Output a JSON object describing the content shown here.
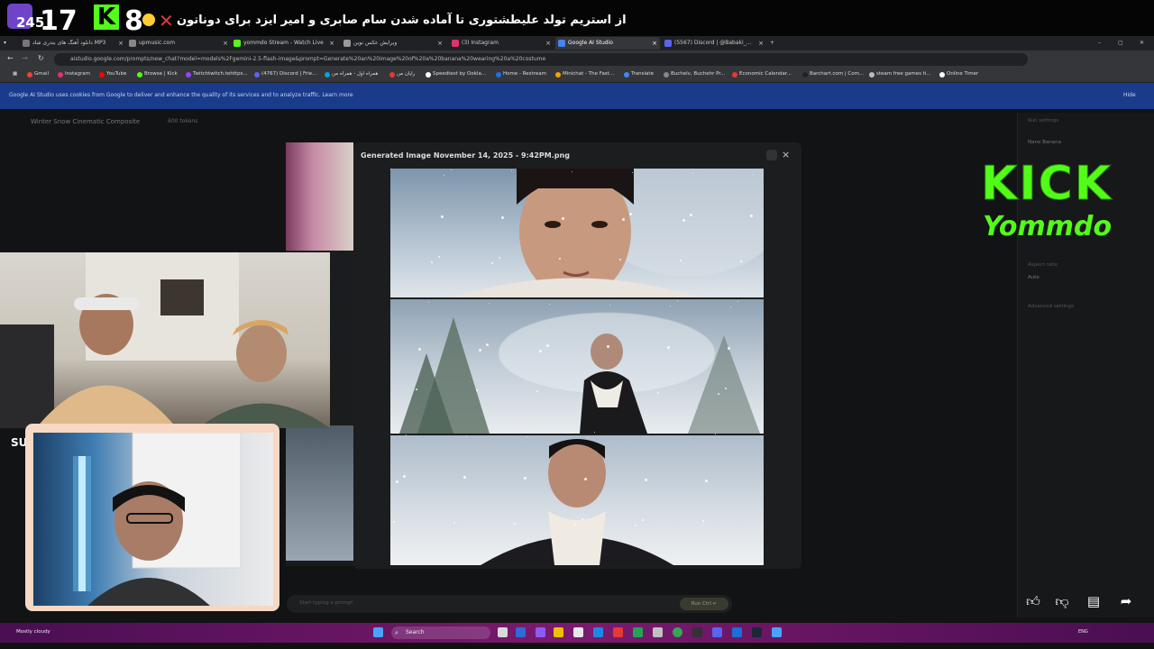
{
  "overlay": {
    "counter": "245",
    "big_17": "17",
    "k_badge": "K",
    "big_8": "8",
    "persian_title": "از استریم تولد علیطشتوری تا آماده شدن سام صابری و امیر ایزد برای دوناتون"
  },
  "tabs": [
    {
      "label": "دانلود آهنگ های بندری شاد MP3",
      "color": "#777"
    },
    {
      "label": "upmusic.com",
      "color": "#888"
    },
    {
      "label": "yommdo Stream - Watch Live",
      "color": "#53fc18"
    },
    {
      "label": "ویرایش عکس نوین",
      "color": "#999"
    },
    {
      "label": "(3) Instagram",
      "color": "#e1306c"
    },
    {
      "label": "Google AI Studio",
      "color": "#4285f4"
    },
    {
      "label": "(5567) Discord | @Babaki_...",
      "color": "#5865f2"
    }
  ],
  "url": "aistudio.google.com/prompts/new_chat?model=models%2Fgemini-2.5-flash-image&prompt=Generate%20an%20image%20of%20a%20banana%20wearing%20a%20costume",
  "bookmarks": [
    {
      "label": "Gmail",
      "color": "#ea4335"
    },
    {
      "label": "Instagram",
      "color": "#e1306c"
    },
    {
      "label": "YouTube",
      "color": "#ff0000"
    },
    {
      "label": "Browse | Kick",
      "color": "#53fc18"
    },
    {
      "label": "Twitchtwitch.tehttps...",
      "color": "#9146ff"
    },
    {
      "label": "(4767) Discord | Frie...",
      "color": "#5865f2"
    },
    {
      "label": "همراه اول - همراه من",
      "color": "#00a3e0"
    },
    {
      "label": "رایان من",
      "color": "#e53935"
    },
    {
      "label": "Speedtest by Ookla...",
      "color": "#ffffff"
    },
    {
      "label": "Home - Restream",
      "color": "#1a73e8"
    },
    {
      "label": "Minichat - The Fast...",
      "color": "#f4a300"
    },
    {
      "label": "Translate",
      "color": "#4285f4"
    },
    {
      "label": "Buchelv, Buchehr Pr...",
      "color": "#888888"
    },
    {
      "label": "Economic Calendar...",
      "color": "#e53935"
    },
    {
      "label": "Barchart.com | Com...",
      "color": "#222222"
    },
    {
      "label": "steam free games ti...",
      "color": "#bbbbbb"
    },
    {
      "label": "Online Timer",
      "color": "#ffffff"
    }
  ],
  "cookie_notice": "Google AI Studio uses cookies from Google to deliver and enhance the quality of its services and to analyze traffic. Learn more",
  "cookie_hide": "Hide",
  "app": {
    "title": "Winter Snow Cinematic Composite",
    "subtitle": "600 tokens",
    "run_settings": "Run settings",
    "model_name": "Nano Banana",
    "aspect_ratio_label": "Aspect ratio",
    "aspect_ratio_value": "Auto",
    "advanced": "Advanced settings",
    "prompt_placeholder": "Start typing a prompt",
    "run_label": "Run Ctrl ↵"
  },
  "modal": {
    "title": "Generated Image November 14, 2025 - 9:42PM.png"
  },
  "brand": {
    "kick": "KICK",
    "name": "Yommdo",
    "color": "#53fc18"
  },
  "webcam": {
    "side_text": "SU"
  },
  "taskbar": {
    "weather": "Mostly cloudy",
    "search": "Search",
    "lang": "ENG"
  },
  "icons": [
    "thumbs-up-icon",
    "thumbs-down-icon",
    "comment-icon",
    "share-icon",
    "close-icon",
    "download-icon",
    "search-icon"
  ]
}
